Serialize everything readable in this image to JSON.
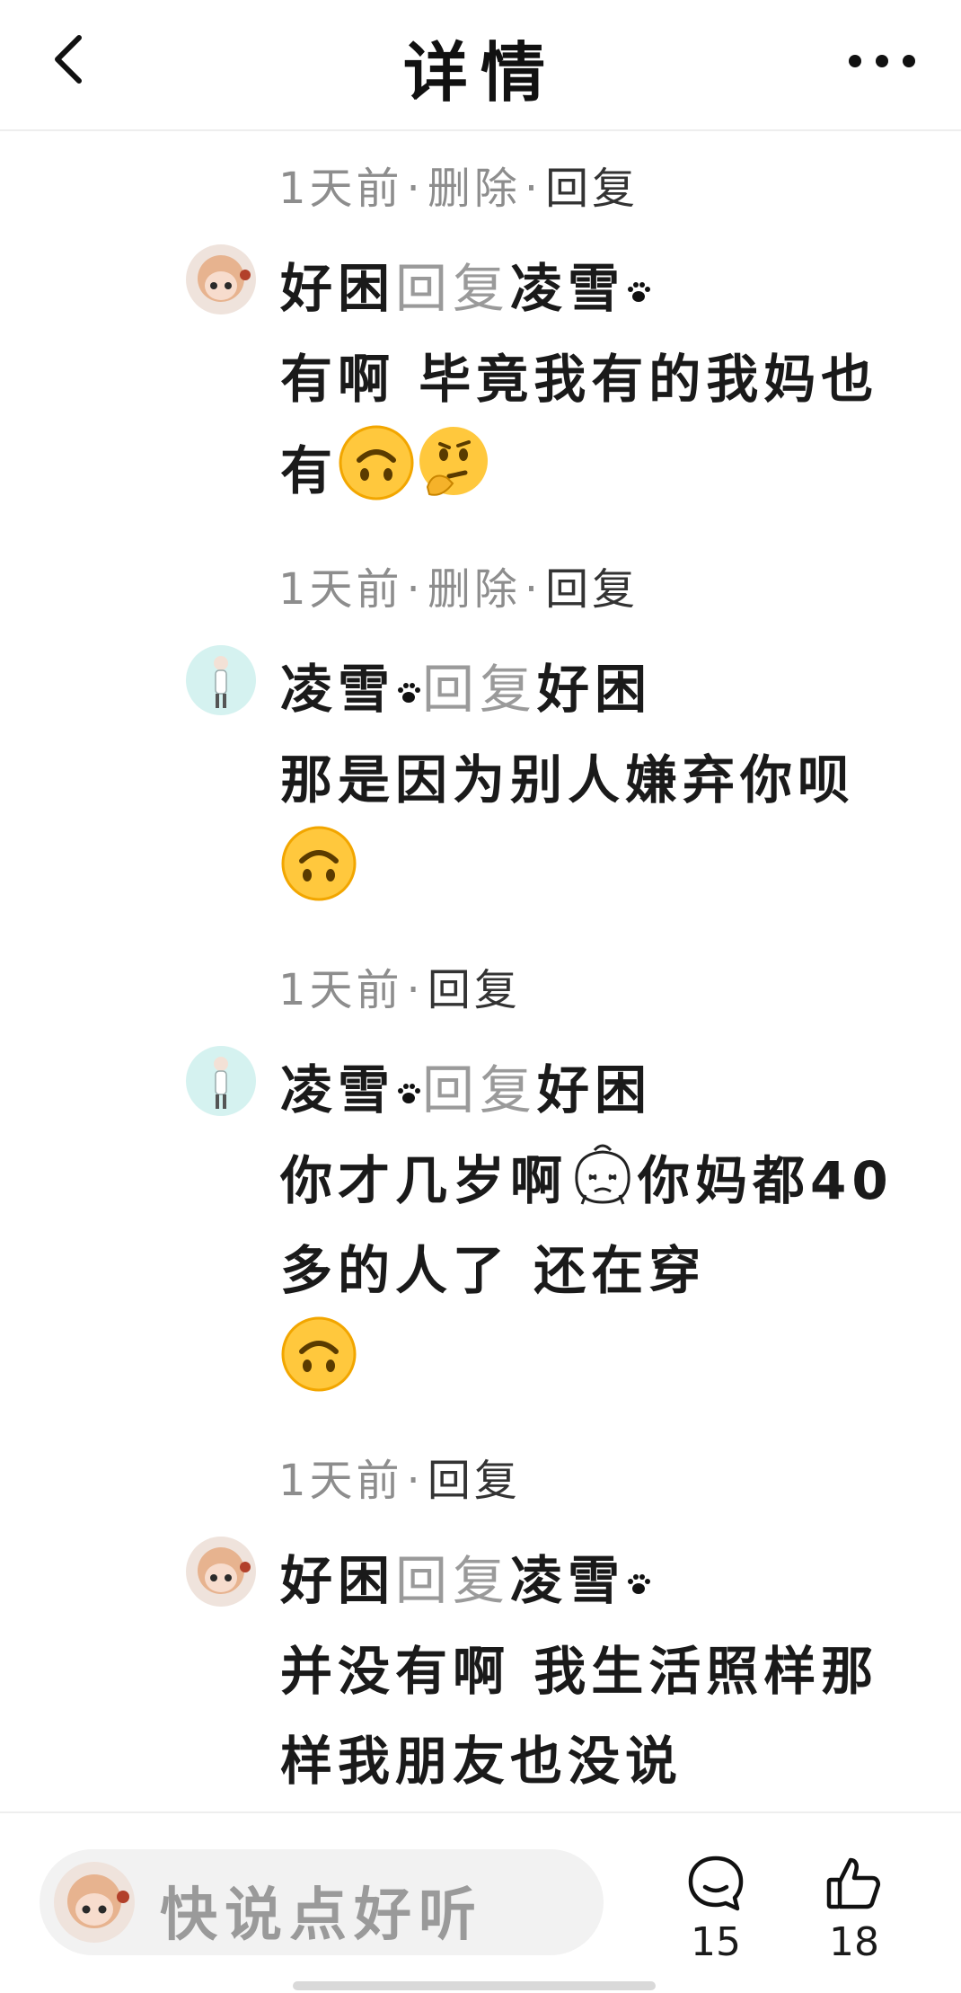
{
  "header": {
    "title": "详情",
    "back_icon": "chevron-left-icon",
    "more_icon": "more-horizontal-icon"
  },
  "comments": [
    {
      "time": "1天前",
      "delete_label": "删除",
      "reply_label": "回复",
      "author": "好困",
      "reply_word": "回复",
      "target": "凌雪",
      "text": "有啊 毕竟我有的我妈也有",
      "emojis": [
        "upside-down-face",
        "thinking-face"
      ]
    },
    {
      "time": "1天前",
      "delete_label": "删除",
      "reply_label": "回复",
      "author": "凌雪",
      "reply_word": "回复",
      "target": "好困",
      "text": "那是因为别人嫌弃你呗",
      "emojis": [
        "upside-down-face"
      ]
    },
    {
      "time": "1天前",
      "reply_label": "回复",
      "author": "凌雪",
      "reply_word": "回复",
      "target": "好困",
      "text_part1": "你才几岁啊",
      "text_part2": "你妈都40多的人了 还在穿",
      "emojis": [
        "doodle-face",
        "upside-down-face"
      ]
    },
    {
      "time": "1天前",
      "reply_label": "回复",
      "author": "好困",
      "reply_word": "回复",
      "target": "凌雪",
      "text": "并没有啊 我生活照样那样我朋友也没说"
    }
  ],
  "bottom_bar": {
    "placeholder": "快说点好听",
    "comment_count": "15",
    "like_count": "18",
    "comment_icon": "comment-bubble-icon",
    "like_icon": "thumbs-up-icon"
  },
  "colors": {
    "meta_gray": "#8d8d8d",
    "reply_gray": "#9a9a9a",
    "emoji_yellow": "#FFC83D"
  }
}
